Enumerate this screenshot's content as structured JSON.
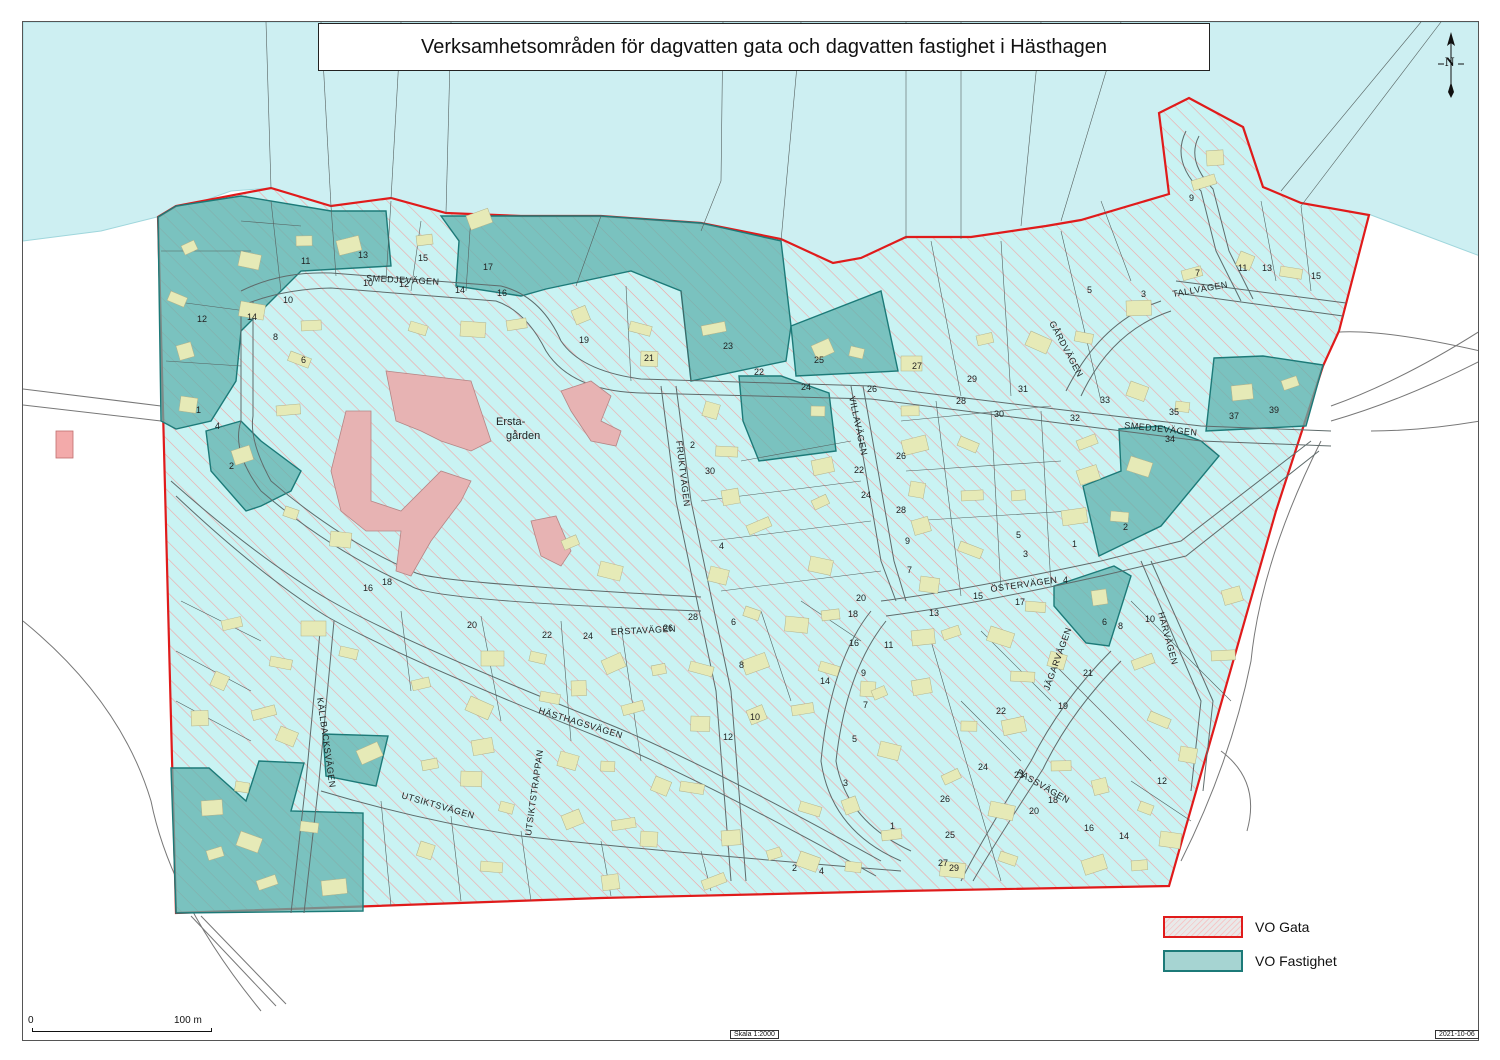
{
  "title": "Verksamhetsområden för dagvatten gata och dagvatten fastighet i Hästhagen",
  "colors": {
    "water": "#cdeff2",
    "area_fill": "#c9f3f3",
    "area_border": "#e01b1b",
    "hatch": "#f2a3a3",
    "fastighet_fill": "#5fb2ae",
    "fastighet_border": "#1c7a78",
    "building": "#e7e6b8",
    "large_building": "#e7b3b3"
  },
  "legend": {
    "gata_label": "VO Gata",
    "fastighet_label": "VO Fastighet"
  },
  "north_arrow": {
    "letter": "N",
    "icon": "north-arrow-icon"
  },
  "scale_bar": {
    "start_label": "0",
    "end_label": "100 m"
  },
  "scale_text": "Skala 1:2000",
  "date_text": "2021-10-06",
  "place_labels": {
    "erstagarden_line1": "Ersta-",
    "erstagarden_line2": "gården"
  },
  "streets": [
    {
      "id": "smedjevagen-w",
      "name": "SMEDJEVÄGEN"
    },
    {
      "id": "smedjevagen-e",
      "name": "SMEDJEVÄGEN"
    },
    {
      "id": "tallvagen",
      "name": "TALLVÄGEN"
    },
    {
      "id": "gardvagen",
      "name": "GÅRDVÄGEN"
    },
    {
      "id": "villavagen",
      "name": "VILLAVÄGEN"
    },
    {
      "id": "fruktvagen",
      "name": "FRUKTVÄGEN"
    },
    {
      "id": "erstavagen",
      "name": "ERSTAVÄGEN"
    },
    {
      "id": "ostervagen",
      "name": "ÖSTERVÄGEN"
    },
    {
      "id": "harvagen",
      "name": "HARVÄGEN"
    },
    {
      "id": "jagarvagen",
      "name": "JÄGARVÄGEN"
    },
    {
      "id": "passvagen",
      "name": "PASSVÄGEN"
    },
    {
      "id": "hasthagsvagen",
      "name": "HÄSTHAGSVÄGEN"
    },
    {
      "id": "utsiktsvagen",
      "name": "UTSIKTSVÄGEN"
    },
    {
      "id": "utsiktstrappan",
      "name": "UTSIKTSTRAPPAN"
    },
    {
      "id": "kallbacksvagen",
      "name": "KÄLLBACKSVÄGEN"
    }
  ],
  "plot_numbers": [
    "11",
    "13",
    "15",
    "17",
    "10",
    "12",
    "14",
    "16",
    "19",
    "21",
    "23",
    "25",
    "27",
    "29",
    "31",
    "33",
    "35",
    "37",
    "39",
    "22",
    "24",
    "26",
    "28",
    "30",
    "32",
    "34",
    "7",
    "9",
    "11",
    "13",
    "15",
    "3",
    "5",
    "1",
    "4",
    "2",
    "6",
    "8",
    "10",
    "12",
    "14",
    "16",
    "18",
    "20",
    "22",
    "24",
    "26",
    "28",
    "30",
    "2",
    "4",
    "6",
    "8",
    "10",
    "12",
    "14",
    "16",
    "18",
    "20",
    "22",
    "24",
    "26",
    "28",
    "9",
    "7",
    "5",
    "3",
    "1",
    "2",
    "4",
    "6",
    "8",
    "10",
    "12",
    "14",
    "16",
    "18",
    "20",
    "22",
    "24",
    "26",
    "1",
    "3",
    "5",
    "7",
    "9",
    "11",
    "13",
    "15",
    "17",
    "19",
    "21",
    "23",
    "25",
    "27",
    "29",
    "4",
    "2"
  ]
}
